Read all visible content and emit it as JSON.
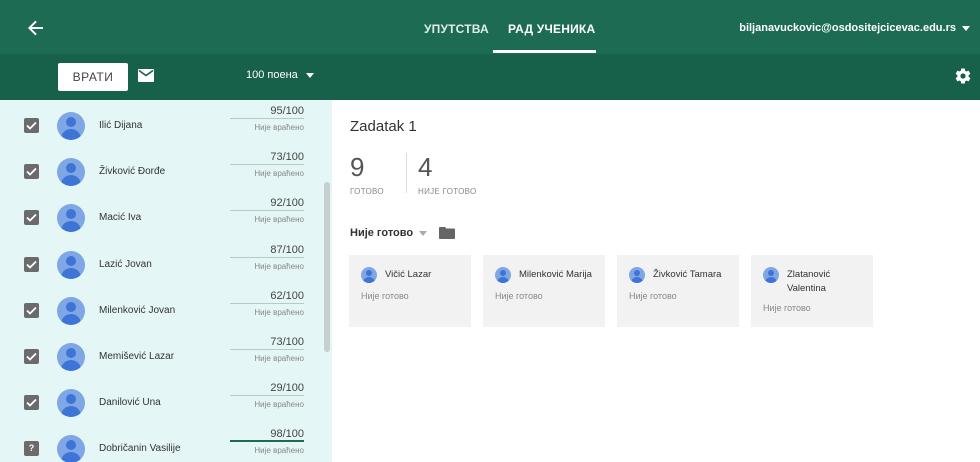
{
  "header": {
    "tabs": [
      {
        "label": "УПУТСТВА"
      },
      {
        "label": "РАД УЧЕНИКА"
      }
    ],
    "account": "biljanavuckovic@osdositejcicevac.edu.rs"
  },
  "toolbar": {
    "return_label": "ВРАТИ",
    "points_label": "100 поена"
  },
  "students": [
    {
      "name": "Ilić Dijana",
      "grade": "95",
      "max": "/100",
      "status": "Није враћено"
    },
    {
      "name": "Živković Đorđe",
      "grade": "73",
      "max": "/100",
      "status": "Није враћено"
    },
    {
      "name": "Macić Iva",
      "grade": "92",
      "max": "/100",
      "status": "Није враћено"
    },
    {
      "name": "Lazić Jovan",
      "grade": "87",
      "max": "/100",
      "status": "Није враћено"
    },
    {
      "name": "Milenković Jovan",
      "grade": "62",
      "max": "/100",
      "status": "Није враћено"
    },
    {
      "name": "Memišević Lazar",
      "grade": "73",
      "max": "/100",
      "status": "Није враћено"
    },
    {
      "name": "Danilović Una",
      "grade": "29",
      "max": "/100",
      "status": "Није враћено"
    },
    {
      "name": "Dobričanin Vasilije",
      "grade": "98",
      "max": "/100",
      "status": "Није враћено"
    }
  ],
  "assignment": {
    "title": "Zadatak 1",
    "done_count": "9",
    "done_label": "ГОТОВО",
    "notdone_count": "4",
    "notdone_label": "НИЈЕ ГОТОВО",
    "filter_label": "Није готово"
  },
  "cards": [
    {
      "name": "Vičić Lazar",
      "status": "Није готово"
    },
    {
      "name": "Milenković Marija",
      "status": "Није готово"
    },
    {
      "name": "Živković Tamara",
      "status": "Није готово"
    },
    {
      "name": "Zlatanović Valentina",
      "status": "Није готово"
    }
  ],
  "colors": {
    "header": "#1d6b52",
    "toolbar": "#176049",
    "panel": "#e4f6f5"
  },
  "icons": [
    "back-arrow-icon",
    "mail-icon",
    "dropdown-arrow-icon",
    "gear-icon",
    "checkbox-icon",
    "avatar-icon",
    "folder-icon"
  ]
}
